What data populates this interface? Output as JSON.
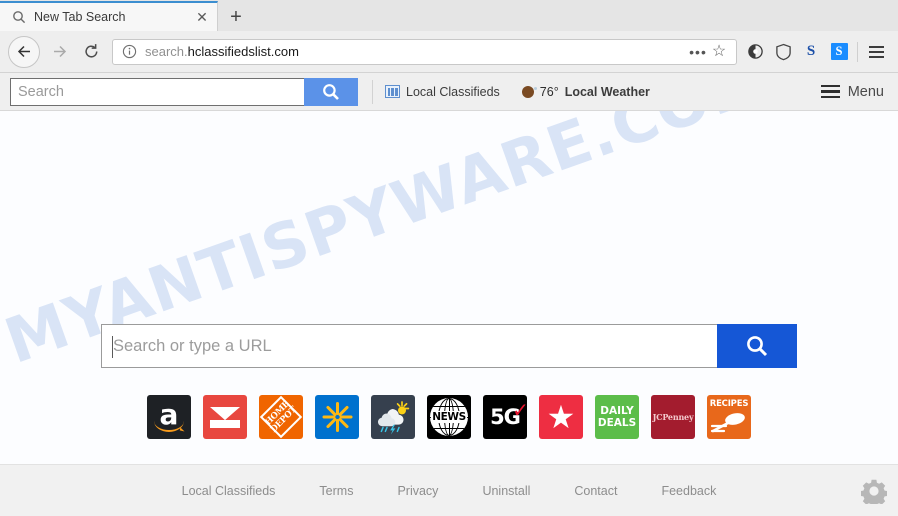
{
  "window": {
    "tab": {
      "title": "New Tab Search",
      "favicon_icon": "search-icon",
      "close_label": "✕",
      "newtab_label": "+"
    }
  },
  "navbar": {
    "back_icon": "arrow-left-icon",
    "forward_icon": "arrow-right-icon",
    "reload_icon": "reload-icon",
    "info_icon": "info-circle-icon",
    "url_scheme": "search.",
    "url_host": "hclassifiedslist.com",
    "url_full": "search.hclassifiedslist.com",
    "page_actions_label": "•••",
    "bookmark_label": "☆",
    "extensions": [
      {
        "name": "pocket-icon",
        "label": ""
      },
      {
        "name": "shield-icon",
        "label": ""
      },
      {
        "name": "skype-letter-icon",
        "label": "S"
      },
      {
        "name": "skype-box-icon",
        "label": "S"
      }
    ],
    "menu_icon": "hamburger-menu-icon"
  },
  "sitebar": {
    "search": {
      "placeholder": "Search",
      "button_icon": "search-icon",
      "button_color": "#5b92e8"
    },
    "classifieds": {
      "label": "Local Classifieds",
      "icon": "newspaper-icon"
    },
    "weather": {
      "icon": "weather-dot-icon",
      "temperature": "76°",
      "label": "Local Weather"
    },
    "menu": {
      "label": "Menu",
      "icon": "hamburger-menu-icon"
    }
  },
  "content": {
    "watermark": "MYANTISPYWARE.COM",
    "watermark_color": "#d3e0f5",
    "hero_search": {
      "placeholder": "Search or type a URL",
      "value": "",
      "button_icon": "search-icon",
      "button_color": "#1557d6"
    },
    "shortcuts": [
      {
        "name": "shortcut-amazon",
        "label": "a",
        "bg": "#1e2125"
      },
      {
        "name": "shortcut-gmail",
        "label": "",
        "bg": "#e8473f"
      },
      {
        "name": "shortcut-home-depot",
        "label": "HOME DEPOT",
        "bg": "#f06500"
      },
      {
        "name": "shortcut-walmart",
        "label": "",
        "bg": "#0071ce"
      },
      {
        "name": "shortcut-weather",
        "label": "",
        "bg": "#36404e"
      },
      {
        "name": "shortcut-news",
        "label": "NEWS",
        "bg": "#000000"
      },
      {
        "name": "shortcut-5g",
        "label": "5G",
        "bg": "#000000"
      },
      {
        "name": "shortcut-macys",
        "label": "★",
        "bg": "#ee2e42"
      },
      {
        "name": "shortcut-daily-deals",
        "label": "DAILY DEALS",
        "bg": "#5cbd4a"
      },
      {
        "name": "shortcut-jcpenney",
        "label": "JCPenney",
        "bg": "#a31c2e"
      },
      {
        "name": "shortcut-recipes",
        "label": "RECIPES",
        "bg": "#e8681b"
      }
    ],
    "home_depot_lines": {
      "line1": "HOME",
      "line2": "DEPOT"
    },
    "daily_deals_lines": {
      "line1": "DAILY",
      "line2": "DEALS"
    }
  },
  "footer": {
    "links": [
      "Local Classifieds",
      "Terms",
      "Privacy",
      "Uninstall",
      "Contact",
      "Feedback"
    ],
    "settings_icon": "gear-icon"
  }
}
